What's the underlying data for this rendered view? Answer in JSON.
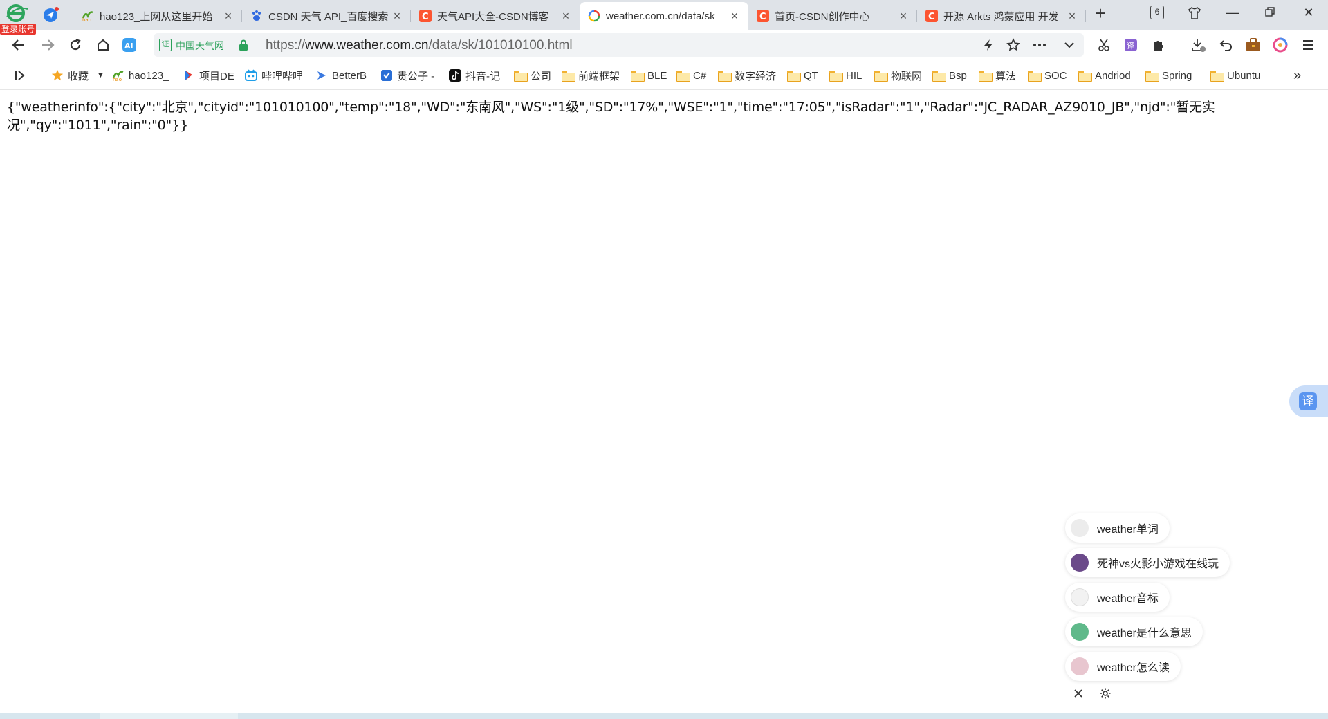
{
  "browser": {
    "login_badge": "登录账号",
    "tab_count": "6"
  },
  "tabs": [
    {
      "title": "hao123_上网从这里开始",
      "favicon": "hao123-icon",
      "active": false
    },
    {
      "title": "CSDN 天气 API_百度搜索",
      "favicon": "baidu-paw-icon",
      "active": false
    },
    {
      "title": "天气API大全-CSDN博客",
      "favicon": "csdn-icon",
      "active": false
    },
    {
      "title": "weather.com.cn/data/sk",
      "favicon": "loading-spinner-icon",
      "active": true
    },
    {
      "title": "首页-CSDN创作中心",
      "favicon": "csdn-icon",
      "active": false
    },
    {
      "title": "开源 Arkts 鸿蒙应用 开发",
      "favicon": "csdn-icon",
      "active": false
    }
  ],
  "address": {
    "site_name": "中国天气网",
    "cert_label": "证",
    "url_prefix": "https://",
    "url_host": "www.weather.com.cn",
    "url_path": "/data/sk/101010100.html"
  },
  "bookmarks": [
    {
      "label": "收藏",
      "icon": "star-icon"
    },
    {
      "label": "hao123_",
      "icon": "hao123-icon"
    },
    {
      "label": "项目DE",
      "icon": "app-icon"
    },
    {
      "label": "哔哩哔哩",
      "icon": "bilibili-icon"
    },
    {
      "label": "BetterB",
      "icon": "arrow-icon"
    },
    {
      "label": "贵公子 -",
      "icon": "shield-icon"
    },
    {
      "label": "抖音-记",
      "icon": "tiktok-icon"
    },
    {
      "label": "公司",
      "icon": "folder-icon"
    },
    {
      "label": "前端框架",
      "icon": "folder-icon"
    },
    {
      "label": "BLE",
      "icon": "folder-icon"
    },
    {
      "label": "C#",
      "icon": "folder-icon"
    },
    {
      "label": "数字经济",
      "icon": "folder-icon"
    },
    {
      "label": "QT",
      "icon": "folder-icon"
    },
    {
      "label": "HIL",
      "icon": "folder-icon"
    },
    {
      "label": "物联网",
      "icon": "folder-icon"
    },
    {
      "label": "Bsp",
      "icon": "folder-icon"
    },
    {
      "label": "算法",
      "icon": "folder-icon"
    },
    {
      "label": "SOC",
      "icon": "folder-icon"
    },
    {
      "label": "Andriod",
      "icon": "folder-icon"
    },
    {
      "label": "Spring",
      "icon": "folder-icon"
    },
    {
      "label": "Ubuntu",
      "icon": "folder-icon"
    }
  ],
  "bookmarks_more": "»",
  "content": {
    "json_text": "{\"weatherinfo\":{\"city\":\"北京\",\"cityid\":\"101010100\",\"temp\":\"18\",\"WD\":\"东南风\",\"WS\":\"1级\",\"SD\":\"17%\",\"WSE\":\"1\",\"time\":\"17:05\",\"isRadar\":\"1\",\"Radar\":\"JC_RADAR_AZ9010_JB\",\"njd\":\"暂无实况\",\"qy\":\"1011\",\"rain\":\"0\"}}"
  },
  "translate_float": {
    "label": "译"
  },
  "suggestions": [
    {
      "text": "weather单词",
      "avatar_color": "#ececec"
    },
    {
      "text": "死神vs火影小游戏在线玩",
      "avatar_color": "#6b4a8a"
    },
    {
      "text": "weather音标",
      "avatar_color": "#f2f2f2"
    },
    {
      "text": "weather是什么意思",
      "avatar_color": "#5fb98a"
    },
    {
      "text": "weather怎么读",
      "avatar_color": "#e8c6cf"
    }
  ],
  "colors": {
    "tabstrip": "#dfe3e8",
    "accent_green": "#2ba15a",
    "csdn_red": "#fc5531",
    "folder_yellow": "#f2b231"
  }
}
